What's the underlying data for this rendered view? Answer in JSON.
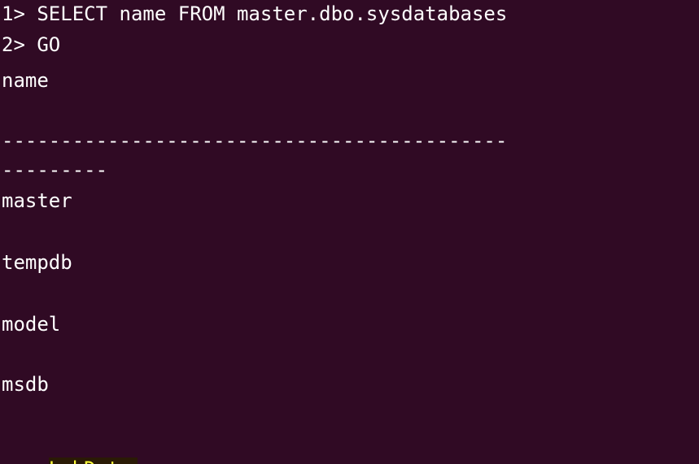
{
  "terminal": {
    "lines": {
      "l1": "1> SELECT name FROM master.dbo.sysdatabases",
      "l2": "2> GO",
      "header": "name",
      "dash1": "-------------------------------------------",
      "dash2": "---------",
      "db1": "master",
      "db2": "tempdb",
      "db3": "model",
      "db4": "msdb",
      "db5": "LabData"
    },
    "highlight_color": "#ffff3a",
    "background_color": "#300a24"
  }
}
